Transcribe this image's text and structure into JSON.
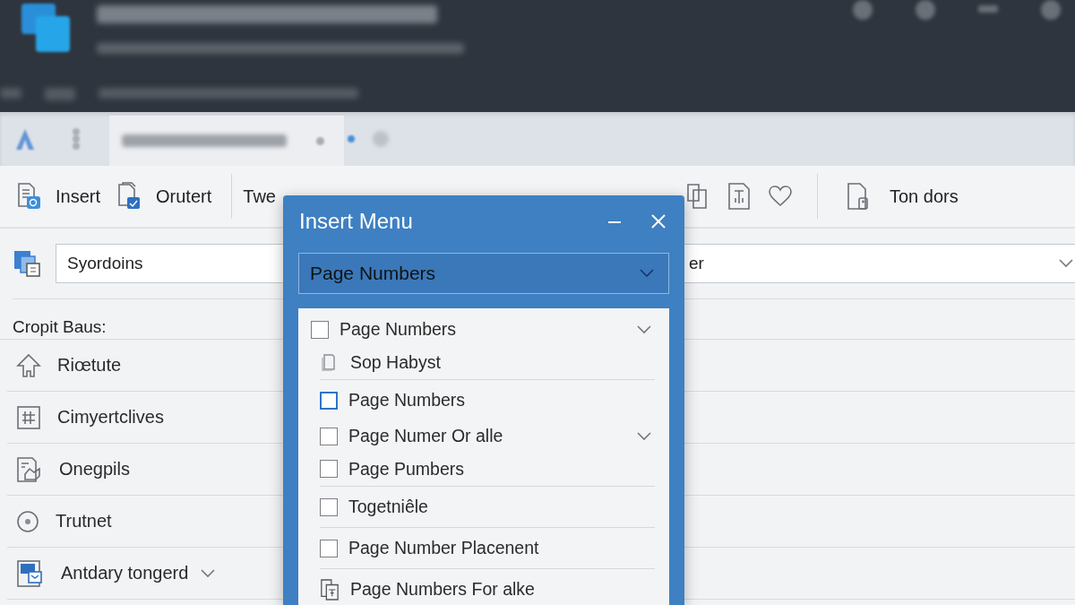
{
  "toolbar": {
    "buttons": [
      {
        "label": "Insert"
      },
      {
        "label": "Orutert"
      },
      {
        "label": "Twe"
      }
    ],
    "right_button": {
      "label": "Ton dors"
    }
  },
  "fields": [
    {
      "value": "Syordoins"
    },
    {
      "value": "er"
    }
  ],
  "section_label": "Cropit Baus:",
  "sidebar_items": [
    {
      "label": "Riœtute",
      "expandable": false
    },
    {
      "label": "Cimyertclives",
      "expandable": false
    },
    {
      "label": "Onegpils",
      "expandable": false
    },
    {
      "label": "Trutnet",
      "expandable": false
    },
    {
      "label": "Antdary tongerd",
      "expandable": true
    }
  ],
  "dialog": {
    "title": "Insert Menu",
    "dropdown": {
      "value": "Page Numbers"
    },
    "items": [
      {
        "kind": "checkbox",
        "label": "Page Numbers",
        "checked": false,
        "focused": false,
        "expandable": true,
        "indented": false,
        "divider_after": false
      },
      {
        "kind": "icon",
        "label": "Sop Habyst",
        "expandable": false,
        "indented": true,
        "divider_after": true
      },
      {
        "kind": "checkbox",
        "label": "Page Numbers",
        "checked": false,
        "focused": true,
        "expandable": false,
        "indented": true,
        "divider_after": false
      },
      {
        "kind": "checkbox",
        "label": "Page Numer Or alle",
        "checked": false,
        "focused": false,
        "expandable": true,
        "indented": true,
        "divider_after": false
      },
      {
        "kind": "checkbox",
        "label": "Page Pumbers",
        "checked": false,
        "focused": false,
        "expandable": false,
        "indented": true,
        "divider_after": true
      },
      {
        "kind": "checkbox",
        "label": "Togetniêle",
        "checked": false,
        "focused": false,
        "expandable": false,
        "indented": true,
        "divider_after": true
      },
      {
        "kind": "checkbox",
        "label": "Page Number Placenent",
        "checked": false,
        "focused": false,
        "expandable": false,
        "indented": true,
        "divider_after": true
      },
      {
        "kind": "icon",
        "label": "Page Numbers For alke",
        "expandable": false,
        "indented": true,
        "divider_after": false
      }
    ]
  }
}
